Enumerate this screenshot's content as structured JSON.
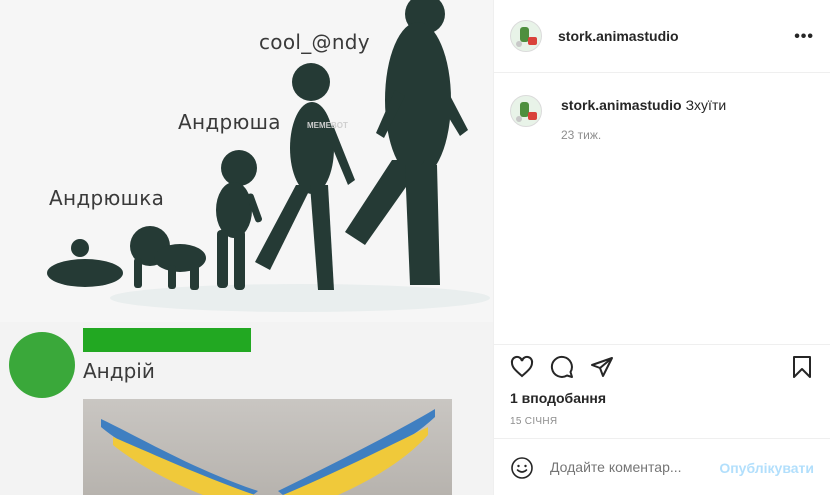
{
  "post": {
    "image_text": {
      "label_1": "Андрюшка",
      "label_2": "Андрюша",
      "label_3": "cool_@ndy",
      "watermark": "MEMEBOT",
      "name": "Андрій"
    }
  },
  "header": {
    "username": "stork.animastudio",
    "more_icon": "more-horizontal-icon"
  },
  "caption": {
    "username": "stork.animastudio",
    "text": "Зхуїти",
    "time": "23 тиж."
  },
  "actions": {
    "like_icon": "heart-icon",
    "comment_icon": "comment-icon",
    "share_icon": "paper-plane-icon",
    "save_icon": "bookmark-icon"
  },
  "stats": {
    "likes": "1 вподобання",
    "date": "15 СІЧНЯ"
  },
  "comment_box": {
    "placeholder": "Додайте коментар...",
    "publish": "Опублікувати",
    "emoji_icon": "smile-icon"
  },
  "colors": {
    "accent_disabled": "#b2dffc",
    "green_avatar": "#3aa83a",
    "green_bar": "#22a822"
  }
}
